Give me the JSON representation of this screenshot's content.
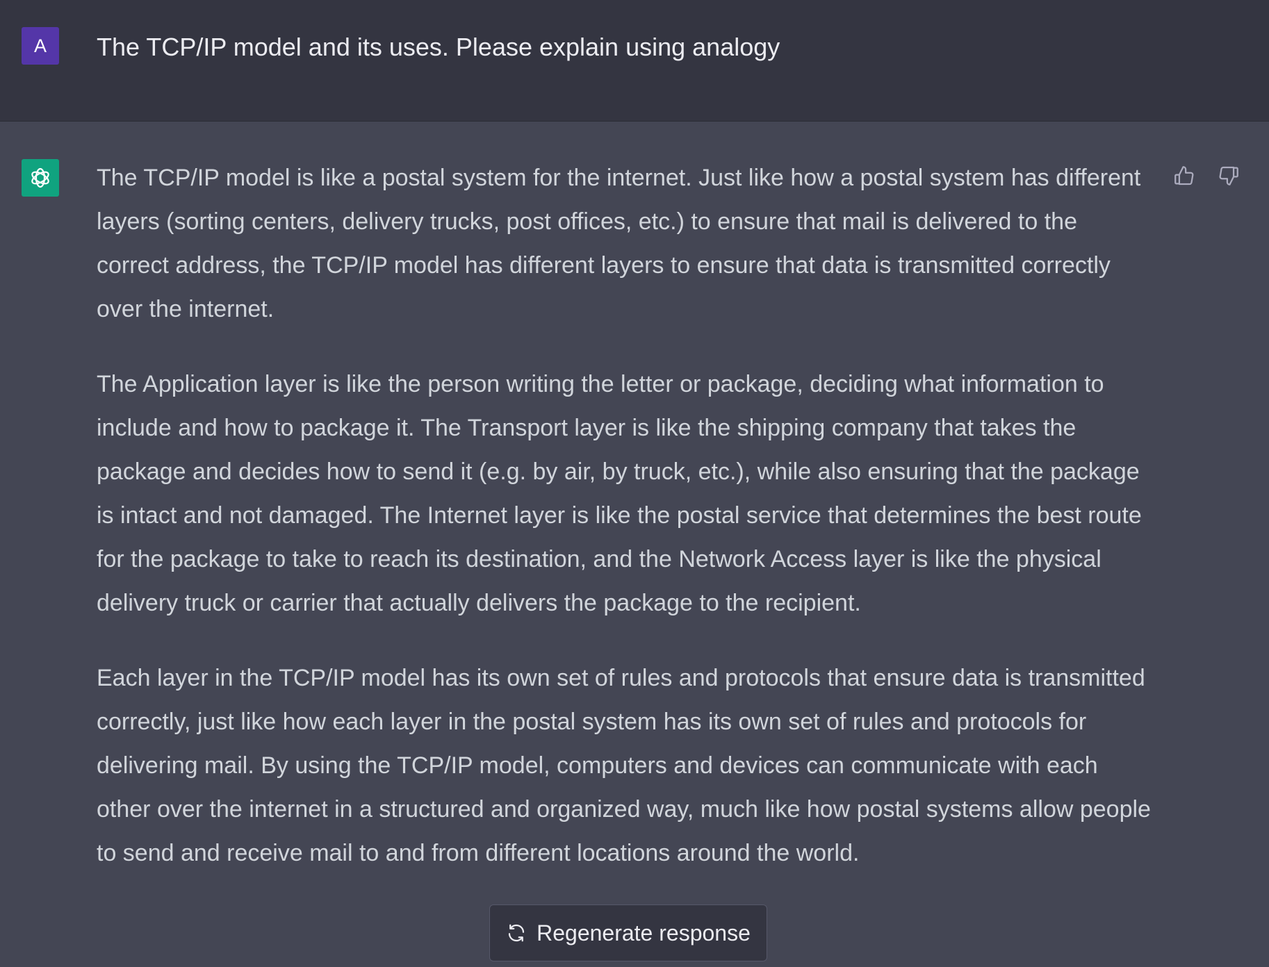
{
  "user_message": {
    "avatar_letter": "A",
    "text": "The TCP/IP model and its uses. Please explain using analogy"
  },
  "assistant_message": {
    "paragraphs": [
      "The TCP/IP model is like a postal system for the internet. Just like how a postal system has different layers (sorting centers, delivery trucks, post offices, etc.) to ensure that mail is delivered to the correct address, the TCP/IP model has different layers to ensure that data is transmitted correctly over the internet.",
      "The Application layer is like the person writing the letter or package, deciding what information to include and how to package it. The Transport layer is like the shipping company that takes the package and decides how to send it (e.g. by air, by truck, etc.), while also ensuring that the package is intact and not damaged. The Internet layer is like the postal service that determines the best route for the package to take to reach its destination, and the Network Access layer is like the physical delivery truck or carrier that actually delivers the package to the recipient.",
      "Each layer in the TCP/IP model has its own set of rules and protocols that ensure data is transmitted correctly, just like how each layer in the postal system has its own set of rules and protocols for delivering mail. By using the TCP/IP model, computers and devices can communicate with each other over the internet in a structured and organized way, much like how postal systems allow people to send and receive mail to and from different locations around the world."
    ],
    "feedback_icons": [
      "thumbs-up-icon",
      "thumbs-down-icon"
    ]
  },
  "regenerate_button": {
    "label": "Regenerate response",
    "icon": "refresh-icon"
  },
  "colors": {
    "user_bg": "#343541",
    "assistant_bg": "#444654",
    "user_avatar": "#5436a8",
    "bot_avatar": "#10a37f",
    "text": "#d1d5db"
  }
}
